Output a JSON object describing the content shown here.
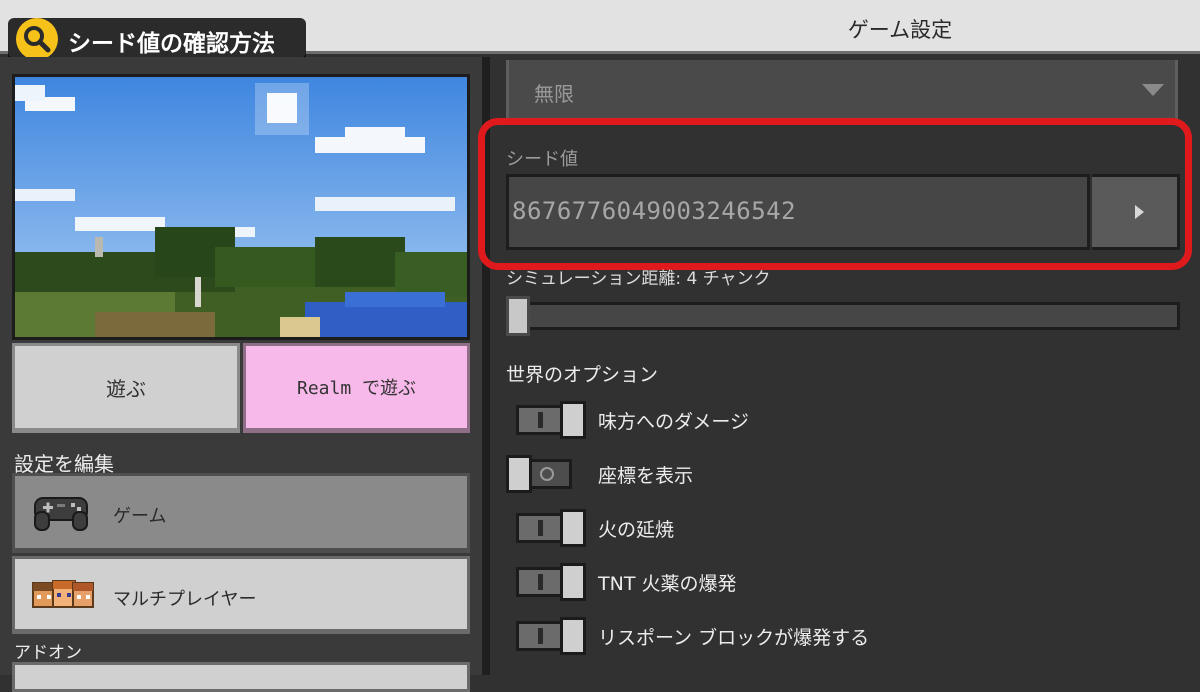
{
  "header": {
    "screen_title": "ゲーム設定",
    "badge_text": "シード値の確認方法"
  },
  "left": {
    "play_label": "遊ぶ",
    "realm_label": "Realm で遊ぶ",
    "edit_section_label": "設定を編集",
    "game_item_label": "ゲーム",
    "multiplayer_item_label": "マルチプレイヤー",
    "addons_section_label": "アドオン"
  },
  "settings": {
    "world_type_value": "無限",
    "seed_label": "シード値",
    "seed_value": "8676776049003246542",
    "simulation_label": "シミュレーション距離: 4 チャンク",
    "simulation_value": 4,
    "world_options_heading": "世界のオプション",
    "options": [
      {
        "label": "味方へのダメージ",
        "state": "on"
      },
      {
        "label": "座標を表示",
        "state": "off"
      },
      {
        "label": "火の延焼",
        "state": "on"
      },
      {
        "label": "TNT 火薬の爆発",
        "state": "on"
      },
      {
        "label": "リスポーン ブロックが爆発する",
        "state": "on"
      }
    ]
  },
  "colors": {
    "highlight": "#e0191d",
    "realm_button": "#f7b8ea",
    "badge_icon": "#f6c21a"
  }
}
